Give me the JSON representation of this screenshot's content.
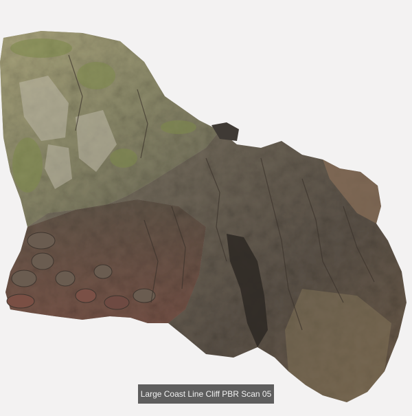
{
  "caption": {
    "title": "Large Coast Line Cliff PBR Scan 05"
  }
}
